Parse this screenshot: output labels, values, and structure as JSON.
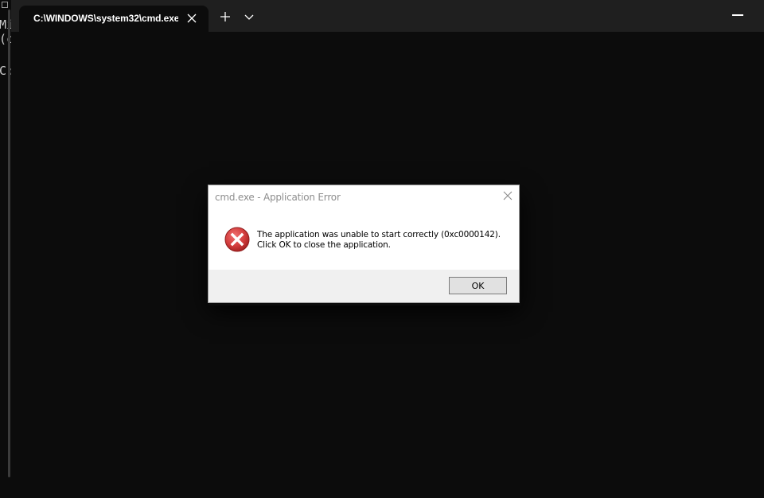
{
  "background_console": {
    "lines": [
      "Mi",
      "(c",
      "C:"
    ]
  },
  "terminal": {
    "tab_title": "C:\\WINDOWS\\system32\\cmd.exe",
    "icons": {
      "tab_close": "close-icon",
      "new_tab": "plus-icon",
      "dropdown": "chevron-down-icon",
      "minimize": "minimize-icon"
    }
  },
  "dialog": {
    "title": "cmd.exe - Application Error",
    "message_line1": "The application was unable to start correctly (0xc0000142).",
    "message_line2": "Click OK to close the application.",
    "ok_label": "OK",
    "icon": "error-icon",
    "colors": {
      "error_red": "#d23c3c",
      "footer_bg": "#f0f0f0"
    }
  }
}
